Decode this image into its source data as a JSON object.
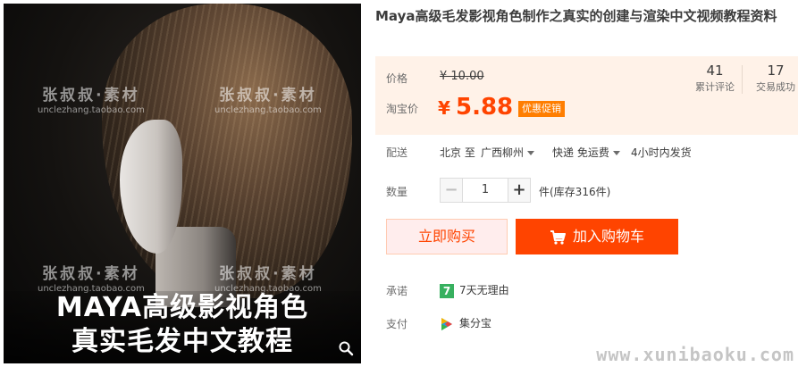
{
  "image": {
    "watermark_name": "张叔叔·素材",
    "watermark_url": "unclezhang.taobao.com",
    "banner_line1": "MAYA高级影视角色",
    "banner_line2": "真实毛发中文教程",
    "zoom_icon": "magnifier-icon"
  },
  "product": {
    "title": "Maya高级毛发影视角色制作之真实的创建与渲染中文视频教程资料"
  },
  "price": {
    "original_label": "价格",
    "original_value": "¥ 10.00",
    "promo_label": "淘宝价",
    "currency": "¥",
    "promo_value": "5.88",
    "promo_tag": "优惠促销"
  },
  "stats": [
    {
      "num": "41",
      "label": "累计评论"
    },
    {
      "num": "17",
      "label": "交易成功"
    }
  ],
  "delivery": {
    "label": "配送",
    "from": "北京 至",
    "to": "广西柳州",
    "method": "快递 免运费",
    "ship_time": "4小时内发货"
  },
  "quantity": {
    "label": "数量",
    "minus": "−",
    "value": "1",
    "plus": "+",
    "stock": "件(库存316件)"
  },
  "buttons": {
    "buy_now": "立即购买",
    "add_to_cart": "加入购物车"
  },
  "promise": {
    "label": "承诺",
    "badge": "7",
    "text": "7天无理由"
  },
  "payment": {
    "label": "支付",
    "text": "集分宝"
  },
  "site_watermark": "www.xunibaoku.com",
  "colors": {
    "accent": "#ff4400",
    "price_bg": "#fff2e8",
    "promo_tag": "#ff7e00",
    "badge_green": "#37b05f"
  }
}
